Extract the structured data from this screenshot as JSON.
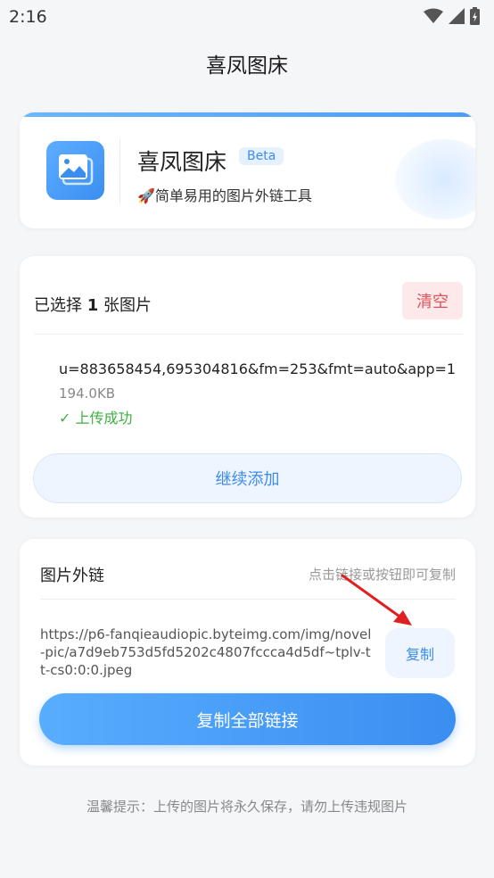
{
  "status_bar": {
    "time": "2:16"
  },
  "app_title": "喜凤图床",
  "header": {
    "brand_name": "喜凤图床",
    "badge": "Beta",
    "slogan": "🚀简单易用的图片外链工具"
  },
  "selection": {
    "title_prefix": "已选择",
    "count": "1",
    "title_suffix": "张图片",
    "clear_label": "清空",
    "file": {
      "name": "u=883658454,695304816&fm=253&fmt=auto&app=1",
      "size": "194.0KB",
      "status": "✓ 上传成功"
    },
    "continue_label": "继续添加"
  },
  "links": {
    "title": "图片外链",
    "hint": "点击链接或按钮即可复制",
    "url": "https://p6-fanqieaudiopic.byteimg.com/img/novel-pic/a7d9eb753d5fd5202c4807fccca4d5df~tplv-tt-cs0:0:0.jpeg",
    "copy_label": "复制",
    "copy_all_label": "复制全部链接"
  },
  "footer_tip": "温馨提示：上传的图片将永久保存，请勿上传违规图片",
  "colors": {
    "accent": "#3d8bf0",
    "danger": "#e0525a",
    "success": "#3cb043",
    "annotation_arrow": "#e02020"
  },
  "icons": [
    "wifi-icon",
    "signal-icon",
    "battery-icon",
    "image-gallery-icon"
  ]
}
